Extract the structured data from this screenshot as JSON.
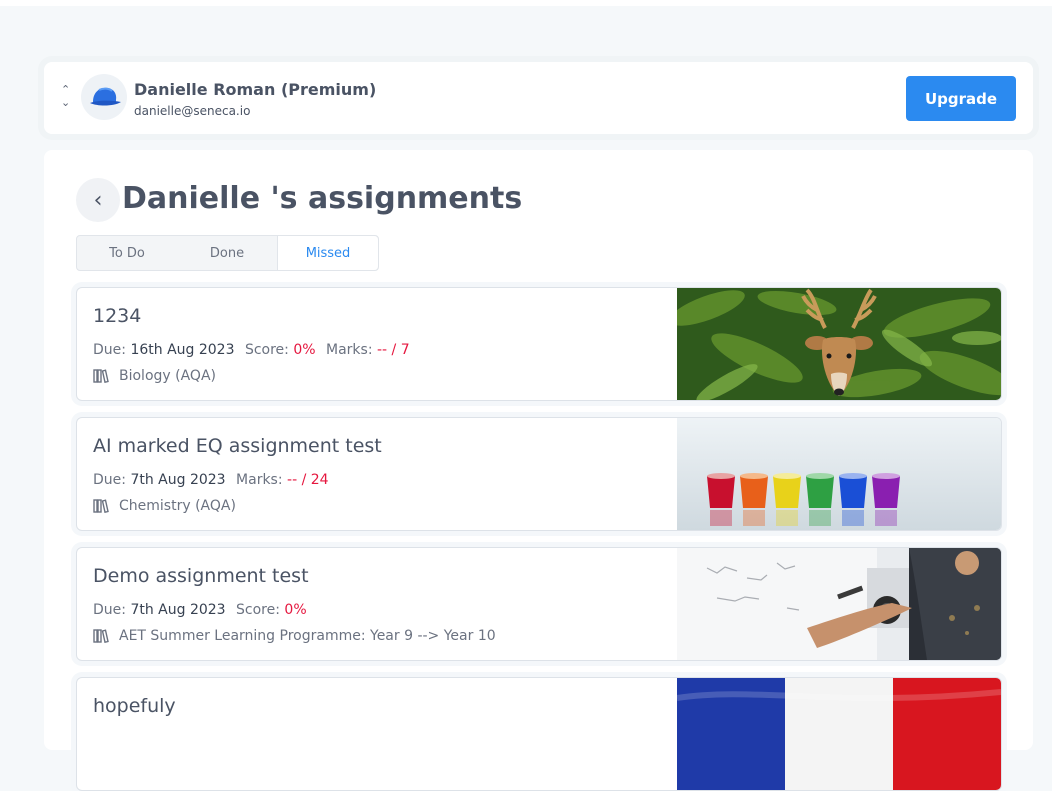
{
  "profile": {
    "name": "Danielle Roman (Premium)",
    "email": "danielle@seneca.io",
    "upgrade_label": "Upgrade"
  },
  "page": {
    "title": "Danielle 's assignments"
  },
  "tabs": [
    {
      "label": "To Do",
      "active": false
    },
    {
      "label": "Done",
      "active": false
    },
    {
      "label": "Missed",
      "active": true
    }
  ],
  "assignments": [
    {
      "title": "1234",
      "due_label": "Due:",
      "due": "16th Aug 2023",
      "score_label": "Score:",
      "score": "0%",
      "marks_label": "Marks:",
      "marks": "-- / 7",
      "course": "Biology (AQA)",
      "image": "deer-in-ferns"
    },
    {
      "title": "AI marked EQ assignment test",
      "due_label": "Due:",
      "due": "7th Aug 2023",
      "marks_label": "Marks:",
      "marks": "-- / 24",
      "course": "Chemistry (AQA)",
      "image": "colored-liquid-glasses"
    },
    {
      "title": "Demo assignment test",
      "due_label": "Due:",
      "due": "7th Aug 2023",
      "score_label": "Score:",
      "score": "0%",
      "course": "AET Summer Learning Programme: Year 9 --> Year 10",
      "image": "person-writing-whiteboard"
    },
    {
      "title": "hopefuly",
      "image": "french-flag"
    }
  ],
  "colors": {
    "accent": "#2b8af0",
    "danger": "#e5173f",
    "text": "#4a5364"
  }
}
